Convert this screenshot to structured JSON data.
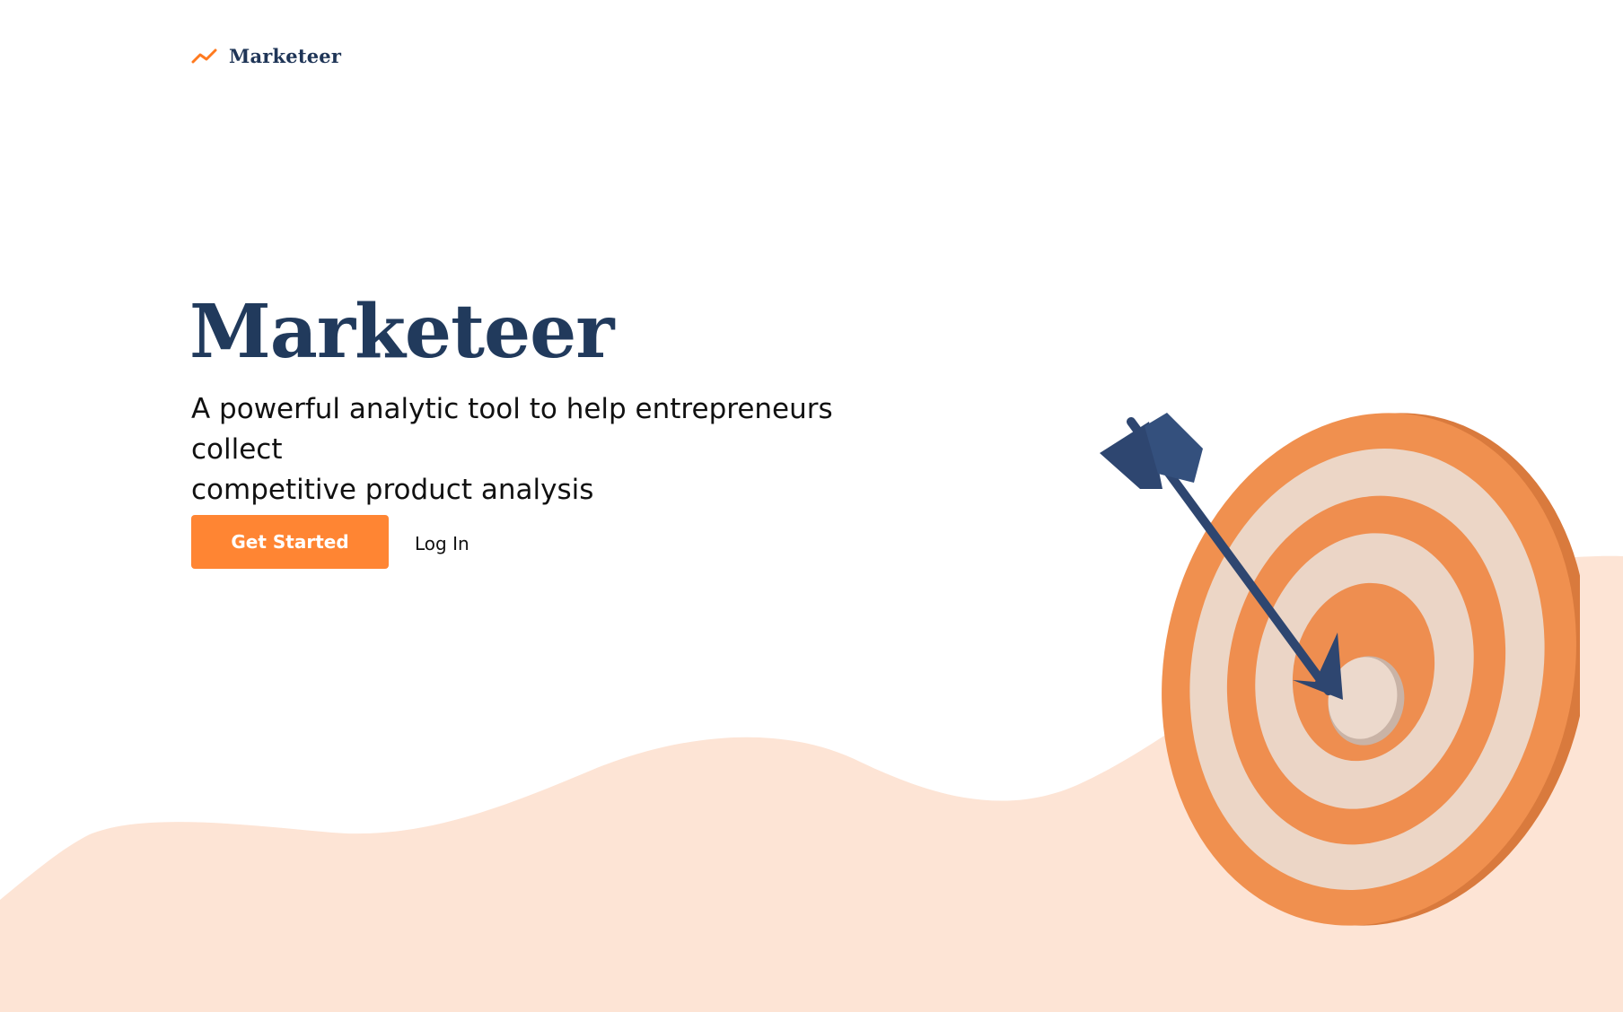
{
  "nav": {
    "brand": "Marketeer",
    "logo_icon": "trend-line-icon"
  },
  "hero": {
    "title": "Marketeer",
    "subtitle_line1": "A powerful analytic tool to help entrepreneurs collect",
    "subtitle_line2": "competitive product analysis",
    "primary_button": "Get Started",
    "secondary_link": "Log In"
  },
  "illustration": {
    "icon": "target-with-arrow-icon"
  },
  "colors": {
    "brand_navy": "#213a5c",
    "accent_orange": "#ff8533",
    "wave_peach": "#fde4d5",
    "ring_orange": "#ef8e4f",
    "ring_cream": "#ecd6c6",
    "arrow_navy": "#2e4670"
  }
}
